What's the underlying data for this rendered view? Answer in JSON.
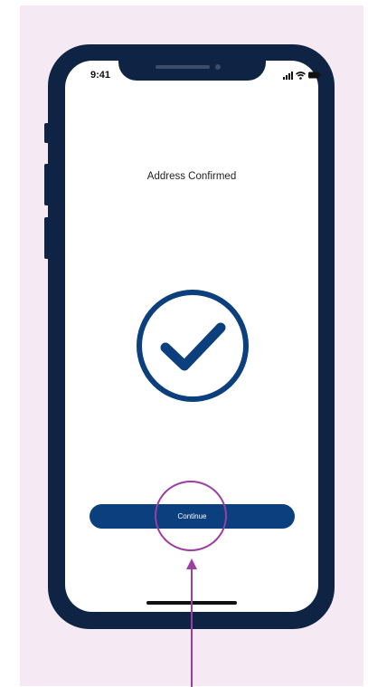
{
  "status_bar": {
    "time": "9:41",
    "icons": [
      "signal-icon",
      "wifi-icon",
      "battery-icon"
    ]
  },
  "screen": {
    "title": "Address Confirmed",
    "status_icon": "checkmark-circle-icon",
    "continue_label": "Continue"
  },
  "annotation": {
    "highlight": "circle around continue button",
    "pointer": "arrow pointing up to continue button"
  },
  "colors": {
    "background_panel": "#f5e9f3",
    "phone_frame": "#0f2344",
    "accent": "#0b3f7d",
    "annotation": "#9b3fa0"
  }
}
